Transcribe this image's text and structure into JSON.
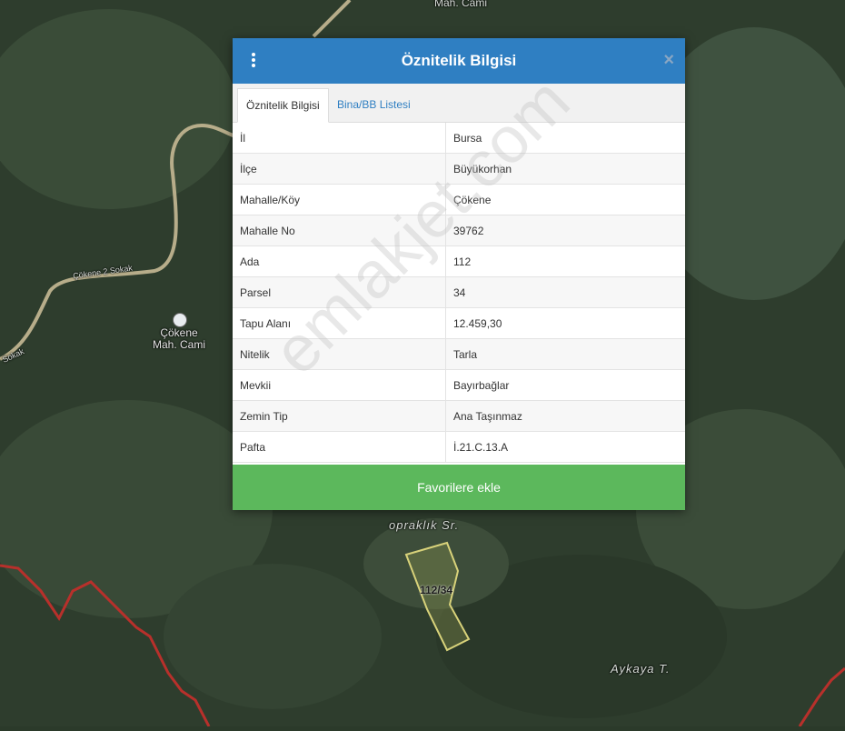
{
  "map": {
    "labels": {
      "top_mosque": "Mah. Cami",
      "road": "Çökene 2 Sokak",
      "road_left": "Sokak",
      "mosque_line1": "Çökene",
      "mosque_line2": "Mah. Cami",
      "place1": "opraklık Sr.",
      "place2": "Aykaya T.",
      "parcel": "112/34"
    }
  },
  "popup": {
    "title": "Öznitelik Bilgisi",
    "close": "×",
    "tabs": [
      {
        "label": "Öznitelik Bilgisi",
        "active": true
      },
      {
        "label": "Bina/BB Listesi",
        "active": false
      }
    ],
    "rows": [
      {
        "key": "İl",
        "value": "Bursa"
      },
      {
        "key": "İlçe",
        "value": "Büyükorhan"
      },
      {
        "key": "Mahalle/Köy",
        "value": "Çökene"
      },
      {
        "key": "Mahalle No",
        "value": "39762"
      },
      {
        "key": "Ada",
        "value": "112"
      },
      {
        "key": "Parsel",
        "value": "34"
      },
      {
        "key": "Tapu Alanı",
        "value": "12.459,30"
      },
      {
        "key": "Nitelik",
        "value": "Tarla"
      },
      {
        "key": "Mevkii",
        "value": "Bayırbağlar"
      },
      {
        "key": "Zemin Tip",
        "value": "Ana Taşınmaz"
      },
      {
        "key": "Pafta",
        "value": "İ.21.C.13.A"
      }
    ],
    "favorite_button": "Favorilere ekle"
  },
  "watermark": "emlakjet.com",
  "colors": {
    "header": "#2f7fc2",
    "button": "#5cb85c",
    "parcel_outline": "#d8d27a",
    "boundary": "#c0302b"
  }
}
